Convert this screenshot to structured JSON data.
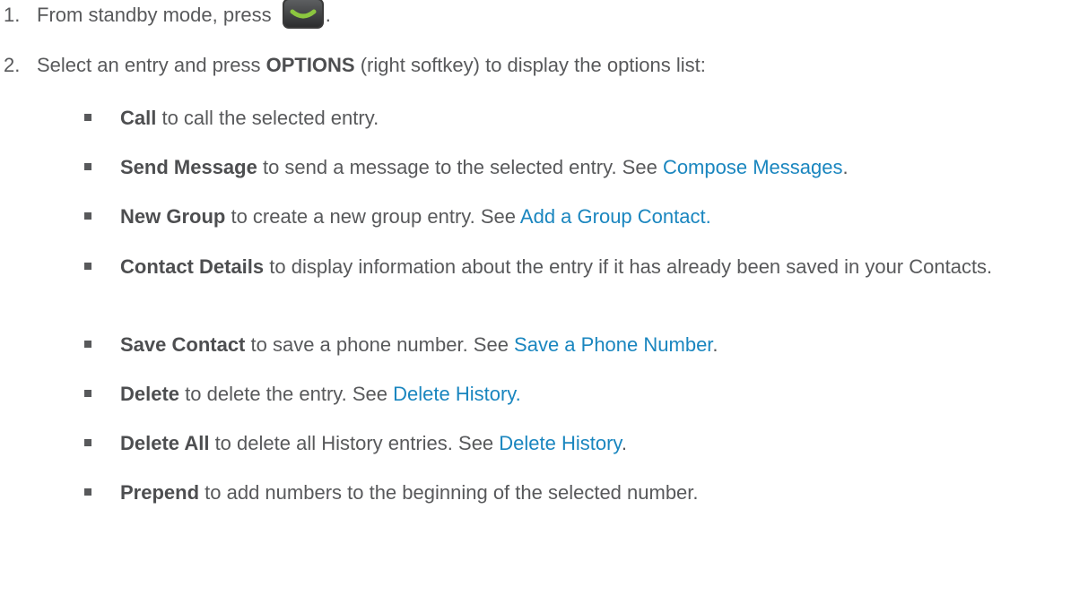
{
  "steps": [
    {
      "number": "1.",
      "text": "From standby mode, press",
      "trail": "."
    },
    {
      "number": "2.",
      "pre": "Select an entry and press ",
      "bold": "OPTIONS",
      "post": " (right softkey) to display the options list:"
    }
  ],
  "key_icon": {
    "name": "talk-key-icon",
    "accent": "#8cc63f"
  },
  "options": [
    {
      "bold": "Call",
      "text": " to call the selected entry.",
      "link": "",
      "post": ""
    },
    {
      "bold": "Send Message",
      "text": " to send a message to the selected entry. See ",
      "link": "Compose Messages",
      "post": "."
    },
    {
      "bold": "New Group",
      "text": " to create a new group entry. See ",
      "link": "Add a Group Contact.",
      "post": ""
    },
    {
      "bold": "Contact Details",
      "text": " to display information about the entry if it has already been saved in your Contacts.",
      "link": "",
      "post": ""
    },
    {
      "bold": "Save Contact",
      "text": " to save a phone number. See ",
      "link": "Save a Phone Number",
      "post": "."
    },
    {
      "bold": "Delete",
      "text": " to delete the entry. See ",
      "link": "Delete History.",
      "post": ""
    },
    {
      "bold": "Delete All",
      "text": " to delete all History entries. See ",
      "link": "Delete History",
      "post": "."
    },
    {
      "bold": "Prepend",
      "text": " to add numbers to the beginning of the selected number.",
      "link": "",
      "post": ""
    }
  ],
  "colors": {
    "text": "#58595b",
    "link": "#1a86bf",
    "bullet": "#58595b"
  }
}
